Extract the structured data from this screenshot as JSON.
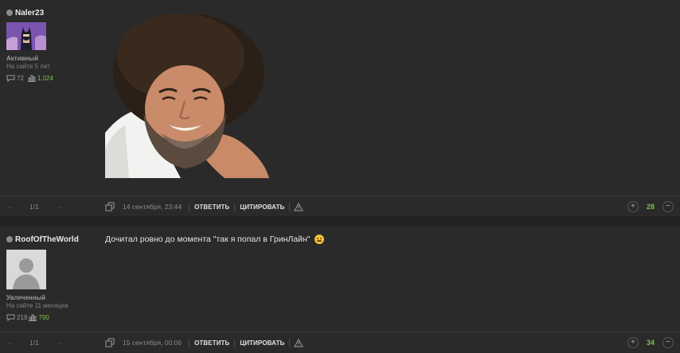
{
  "posts": [
    {
      "username": "Naler23",
      "status": "Активный",
      "since": "На сайте 5 лет",
      "comments_count": "72",
      "rating": "1,024",
      "page": "1/1",
      "date": "14 сентября, 23:44",
      "reply_label": "ОТВЕТИТЬ",
      "quote_label": "ЦИТИРОВАТЬ",
      "score": "28"
    },
    {
      "username": "RoofOfTheWorld",
      "status": "Увлеченный",
      "since": "На сайте 11 месяцев",
      "comments_count": "219",
      "rating": "790",
      "text": "Дочитал ровно до момента \"так я попал в ГринЛайн\"",
      "page": "1/1",
      "date": "15 сентября, 00:06",
      "reply_label": "ОТВЕТИТЬ",
      "quote_label": "ЦИТИРОВАТЬ",
      "score": "34"
    }
  ],
  "icons": {
    "online": "status-dot-icon",
    "comments": "comment-bubble-icon",
    "rating": "rating-bars-icon",
    "prev": "arrow-left-icon",
    "next": "arrow-right-icon",
    "copy": "copy-icon",
    "report": "warning-icon",
    "upvote": "plus-icon",
    "downvote": "minus-icon",
    "emoji": "smile-emoji-icon"
  },
  "colors": {
    "accent_green": "#7ec04a",
    "background": "#2a2a2a"
  }
}
